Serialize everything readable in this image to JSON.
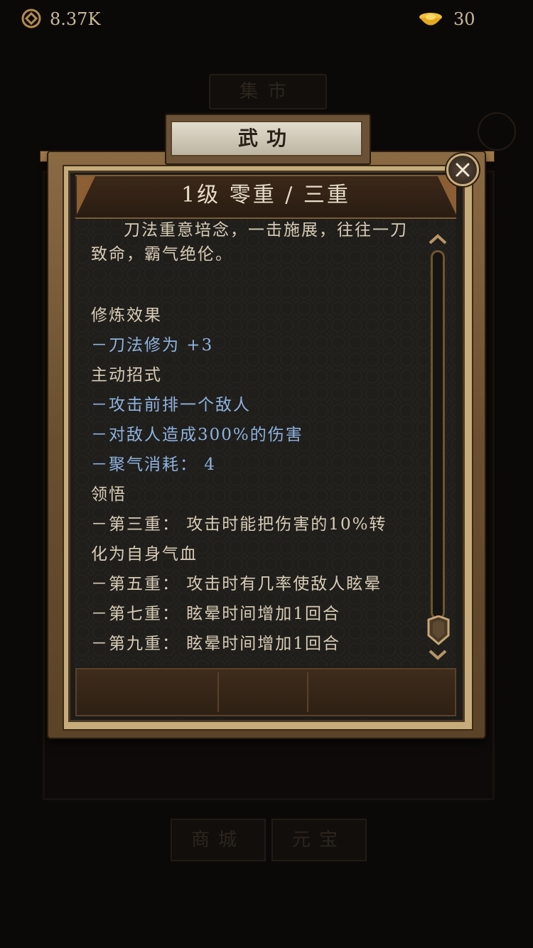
{
  "currency": {
    "coins": "8.37K",
    "ingots": "30"
  },
  "background": {
    "tab_label": "集市",
    "buttons": [
      "商城",
      "元宝"
    ]
  },
  "dialog": {
    "title": "武功",
    "header": "1级 零重 / 三重",
    "description_lines": [
      "刀法重意培念，一击施展，往往一刀",
      "致命，霸气绝伦。"
    ],
    "sections": {
      "effect_title": "修炼效果",
      "effect_items": [
        "－刀法修为 +3"
      ],
      "active_title": "主动招式",
      "active_items": [
        "－攻击前排一个敌人",
        "－对敌人造成300%的伤害",
        "－聚气消耗： 4"
      ],
      "insight_title": "领悟",
      "insight_lines": [
        "－第三重： 攻击时能把伤害的10%转",
        "化为自身气血",
        "－第五重： 攻击时有几率使敌人眩晕",
        "－第七重： 眩晕时间增加1回合",
        "－第九重： 眩晕时间增加1回合"
      ]
    }
  },
  "colors": {
    "highlight_blue": "#8fb2df",
    "text": "#d8ccb6",
    "frame_brown": "#6a4e2f"
  },
  "icons": {
    "coins": "copper-coin-icon",
    "ingots": "gold-ingot-icon",
    "close": "close-icon"
  }
}
